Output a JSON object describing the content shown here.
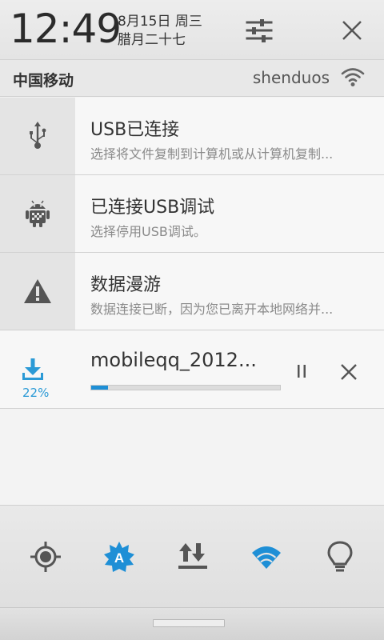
{
  "header": {
    "time": "12:49",
    "date": "8月15日 周三",
    "lunar_date": "腊月二十七"
  },
  "status": {
    "carrier": "中国移动",
    "wifi_ssid": "shenduos"
  },
  "notifications": [
    {
      "icon": "usb-icon",
      "title": "USB已连接",
      "text": "选择将文件复制到计算机或从计算机复制..."
    },
    {
      "icon": "android-debug-icon",
      "title": "已连接USB调试",
      "text": "选择停用USB调试。"
    },
    {
      "icon": "warning-icon",
      "title": "数据漫游",
      "text": "数据连接已断，因为您已离开本地网络并..."
    }
  ],
  "download": {
    "filename": "mobileqq_2012...",
    "percent_label": "22%",
    "progress": 0.09
  },
  "quick_toggles": [
    "gps-icon",
    "auto-brightness-icon",
    "data-sync-icon",
    "wifi-icon",
    "flashlight-icon"
  ],
  "colors": {
    "accent": "#1e8fd6",
    "icon_gray": "#555555"
  }
}
